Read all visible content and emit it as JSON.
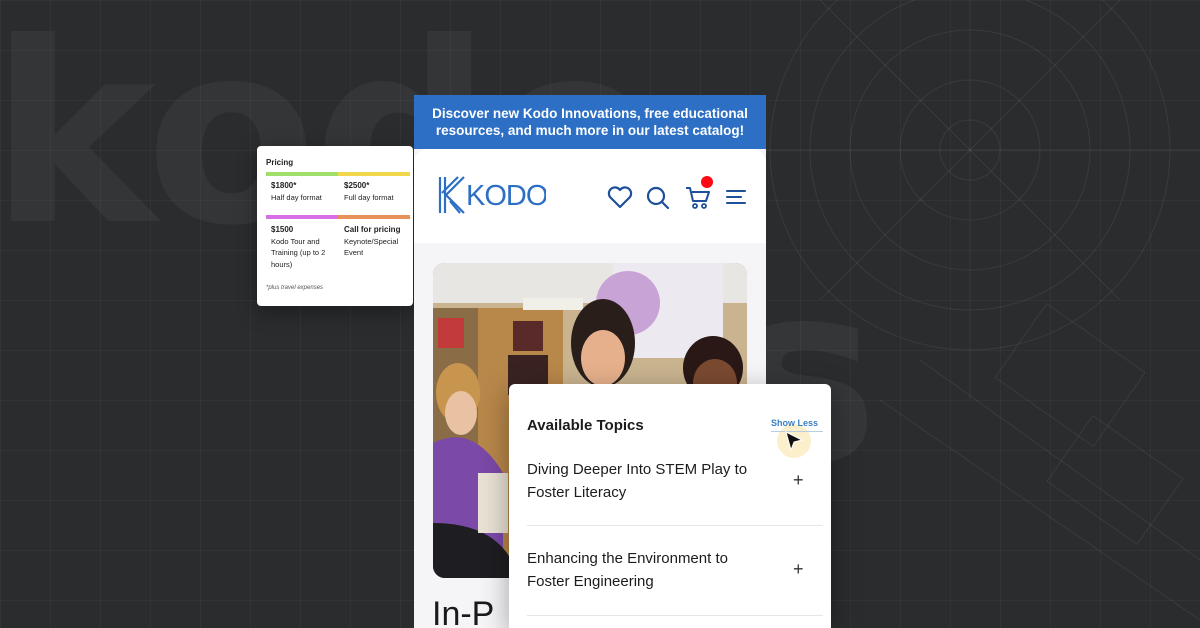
{
  "background": {
    "watermark_text": "kodo",
    "watermark_s": "s"
  },
  "pricing": {
    "title": "Pricing",
    "cells": [
      {
        "price": "$1800*",
        "desc": "Half day format",
        "color": "#9ee06a"
      },
      {
        "price": "$2500*",
        "desc": "Full day format",
        "color": "#f2d64b"
      },
      {
        "price": "$1500",
        "desc": "Kodo Tour and Training (up to 2 hours)",
        "color": "#d86ee6"
      },
      {
        "price": "Call for pricing",
        "desc": "Keynote/Special Event",
        "color": "#e8915a"
      }
    ],
    "note": "*plus travel expenses"
  },
  "promo": {
    "line1": "Discover new Kodo Innovations, free educational",
    "line2": "resources, and much more in our latest catalog!"
  },
  "nav": {
    "logo_text": "KODO",
    "icons": [
      "heart-icon",
      "search-icon",
      "cart-icon",
      "menu-icon"
    ],
    "brand_color": "#2d6fc4",
    "cart_dot_color": "#ff0a14"
  },
  "page": {
    "heading": "In-P"
  },
  "topics": {
    "title": "Available Topics",
    "show_less": "Show Less",
    "items": [
      {
        "line1": "Diving Deeper Into STEM Play to",
        "line2": "Foster Literacy"
      },
      {
        "line1": "Enhancing the Environment to",
        "line2": "Foster Engineering"
      }
    ],
    "expand_symbol": "+"
  }
}
